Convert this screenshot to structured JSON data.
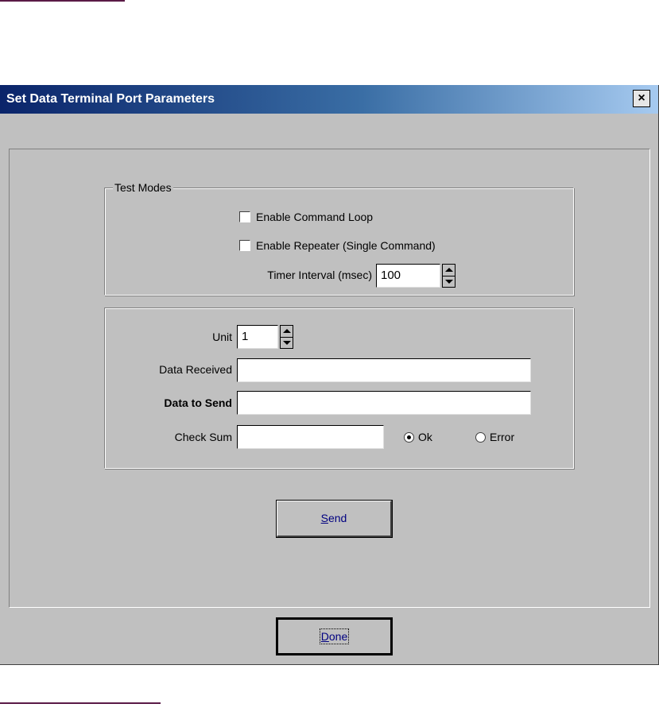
{
  "window": {
    "title": "Set Data Terminal Port Parameters",
    "close_label": "×"
  },
  "test_modes": {
    "legend": "Test Modes",
    "enable_command_loop": {
      "label": "Enable Command Loop",
      "checked": false
    },
    "enable_repeater": {
      "label": "Enable Repeater (Single Command)",
      "checked": false
    },
    "timer_interval": {
      "label": "Timer Interval (msec)",
      "value": "100"
    }
  },
  "data_panel": {
    "unit": {
      "label": "Unit",
      "value": "1"
    },
    "data_received": {
      "label": "Data Received",
      "value": ""
    },
    "data_to_send": {
      "label": "Data to Send",
      "value": ""
    },
    "check_sum": {
      "label": "Check Sum",
      "value": ""
    },
    "status": {
      "ok_label": "Ok",
      "error_label": "Error",
      "selected": "Ok"
    }
  },
  "buttons": {
    "send_mnemonic": "S",
    "send_rest": "end",
    "done_mnemonic": "D",
    "done_rest": "one"
  },
  "colors": {
    "accent_line": "#5a1a46",
    "titlebar_start": "#0a246a",
    "titlebar_end": "#a6caf0",
    "dialog_background": "#c0c0c0",
    "button_text": "#000080"
  }
}
